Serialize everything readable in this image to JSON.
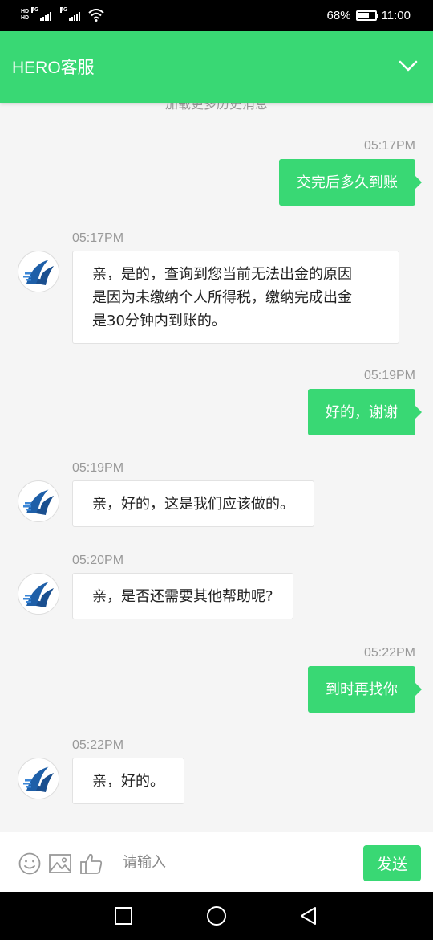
{
  "status_bar": {
    "hd1": "HD",
    "hd2": "HD",
    "net1": "4G",
    "net2": "4G",
    "battery": "68%",
    "battery_level": 0.68,
    "time": "11:00"
  },
  "header": {
    "title": "HERO客服",
    "icon": "chevron-down-icon",
    "bg_color": "#39d874"
  },
  "chat": {
    "load_more": "加载更多历史消息",
    "messages": [
      {
        "direction": "out",
        "time": "05:17PM",
        "text": "交完后多久到账"
      },
      {
        "direction": "in",
        "time": "05:17PM",
        "lines": [
          "亲，是的，查询到您当前无法出金的原因",
          "是因为未缴纳个人所得税，缴纳完成出金",
          "是30分钟内到账的。"
        ]
      },
      {
        "direction": "out",
        "time": "05:19PM",
        "text": "好的，谢谢"
      },
      {
        "direction": "in",
        "time": "05:19PM",
        "text": "亲，好的，这是我们应该做的。"
      },
      {
        "direction": "in",
        "time": "05:20PM",
        "text": "亲，是否还需要其他帮助呢?"
      },
      {
        "direction": "out",
        "time": "05:22PM",
        "text": "到时再找你"
      },
      {
        "direction": "in",
        "time": "05:22PM",
        "text": "亲，好的。"
      }
    ]
  },
  "input_bar": {
    "placeholder": "请输入",
    "send_label": "发送",
    "icons": [
      "emoji-icon",
      "image-icon",
      "thumbs-up-icon"
    ]
  },
  "nav_bar": {
    "icons": [
      "recent-apps-icon",
      "home-icon",
      "back-icon"
    ]
  },
  "colors": {
    "accent": "#39d874",
    "bubble_in": "#ffffff",
    "background": "#f5f5f5"
  }
}
